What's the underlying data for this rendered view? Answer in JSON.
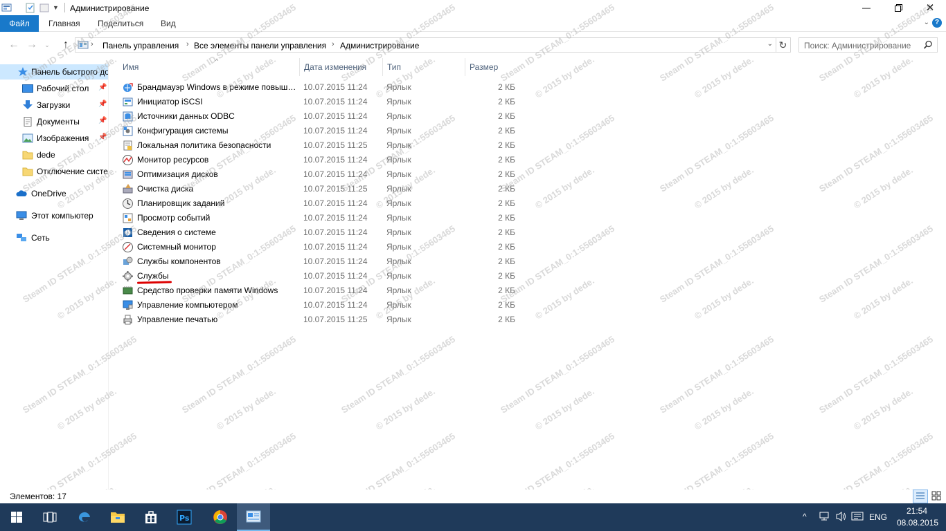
{
  "window": {
    "title": "Администрирование"
  },
  "ribbon": {
    "tabs": [
      "Файл",
      "Главная",
      "Поделиться",
      "Вид"
    ]
  },
  "address": {
    "crumbs": [
      "Панель управления",
      "Все элементы панели управления",
      "Администрирование"
    ]
  },
  "search": {
    "placeholder": "Поиск: Администрирование"
  },
  "nav": {
    "quick_access": "Панель быстрого доступа",
    "items": [
      "Рабочий стол",
      "Загрузки",
      "Документы",
      "Изображения",
      "dede",
      "Отключение системы"
    ],
    "onedrive": "OneDrive",
    "this_pc": "Этот компьютер",
    "network": "Сеть"
  },
  "columns": {
    "name": "Имя",
    "date": "Дата изменения",
    "type": "Тип",
    "size": "Размер"
  },
  "files": [
    {
      "name": "Брандмауэр Windows в режиме повышенной безопасности",
      "date": "10.07.2015 11:24",
      "type": "Ярлык",
      "size": "2 КБ"
    },
    {
      "name": "Инициатор iSCSI",
      "date": "10.07.2015 11:24",
      "type": "Ярлык",
      "size": "2 КБ"
    },
    {
      "name": "Источники данных ODBC",
      "date": "10.07.2015 11:24",
      "type": "Ярлык",
      "size": "2 КБ"
    },
    {
      "name": "Конфигурация системы",
      "date": "10.07.2015 11:24",
      "type": "Ярлык",
      "size": "2 КБ"
    },
    {
      "name": "Локальная политика безопасности",
      "date": "10.07.2015 11:25",
      "type": "Ярлык",
      "size": "2 КБ"
    },
    {
      "name": "Монитор ресурсов",
      "date": "10.07.2015 11:24",
      "type": "Ярлык",
      "size": "2 КБ"
    },
    {
      "name": "Оптимизация дисков",
      "date": "10.07.2015 11:24",
      "type": "Ярлык",
      "size": "2 КБ"
    },
    {
      "name": "Очистка диска",
      "date": "10.07.2015 11:25",
      "type": "Ярлык",
      "size": "2 КБ"
    },
    {
      "name": "Планировщик заданий",
      "date": "10.07.2015 11:24",
      "type": "Ярлык",
      "size": "2 КБ"
    },
    {
      "name": "Просмотр событий",
      "date": "10.07.2015 11:24",
      "type": "Ярлык",
      "size": "2 КБ"
    },
    {
      "name": "Сведения о системе",
      "date": "10.07.2015 11:24",
      "type": "Ярлык",
      "size": "2 КБ"
    },
    {
      "name": "Системный монитор",
      "date": "10.07.2015 11:24",
      "type": "Ярлык",
      "size": "2 КБ"
    },
    {
      "name": "Службы компонентов",
      "date": "10.07.2015 11:24",
      "type": "Ярлык",
      "size": "2 КБ"
    },
    {
      "name": "Службы",
      "date": "10.07.2015 11:24",
      "type": "Ярлык",
      "size": "2 КБ"
    },
    {
      "name": "Средство проверки памяти Windows",
      "date": "10.07.2015 11:24",
      "type": "Ярлык",
      "size": "2 КБ"
    },
    {
      "name": "Управление компьютером",
      "date": "10.07.2015 11:24",
      "type": "Ярлык",
      "size": "2 КБ"
    },
    {
      "name": "Управление печатью",
      "date": "10.07.2015 11:25",
      "type": "Ярлык",
      "size": "2 КБ"
    }
  ],
  "status": {
    "count": "Элементов: 17"
  },
  "watermark": {
    "line1": "Steam ID  STEAM_0:1:55603465",
    "line2": "© 2015 by dede."
  },
  "taskbar": {
    "lang": "ENG",
    "time": "21:54",
    "date": "08.08.2015"
  },
  "colors": {
    "accent": "#1979ca",
    "selection": "#cce8ff",
    "taskbar": "#1f3a5a",
    "annotation": "#dd0000"
  }
}
